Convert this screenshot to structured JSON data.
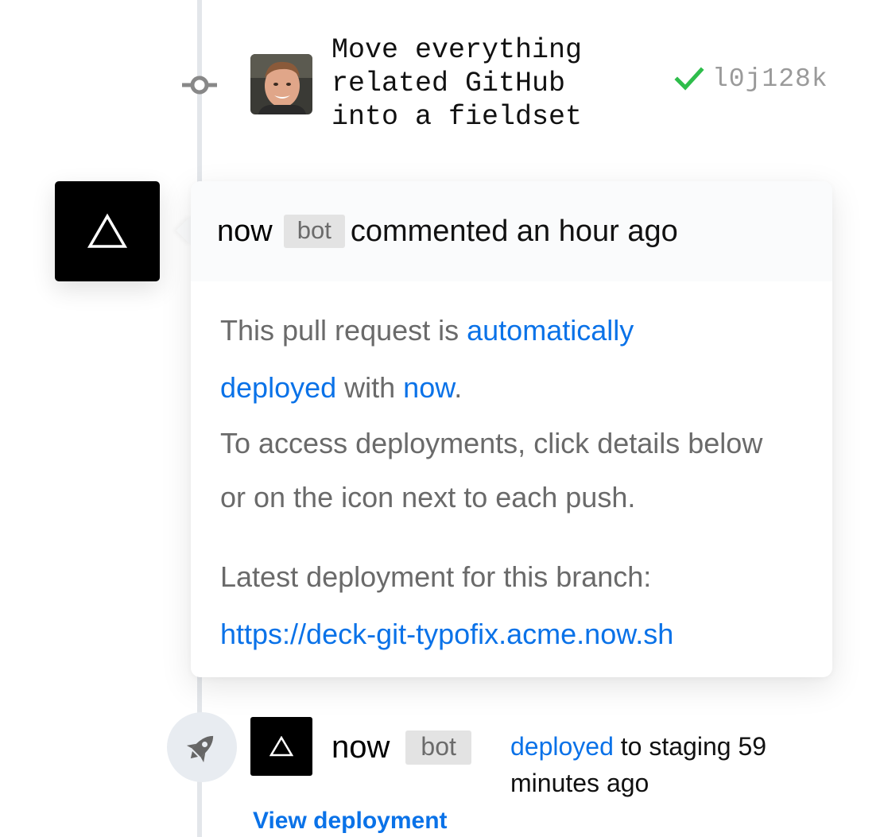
{
  "commit": {
    "message": "Move everything\nrelated GitHub\ninto a fieldset",
    "sha": "l0j128k",
    "status_icon": "check-icon",
    "status_color": "#2ebd4b"
  },
  "comment": {
    "author": "now",
    "badge": "bot",
    "meta": "commented an hour ago",
    "body": {
      "p1_text1": "This pull request is ",
      "p1_link1": "automatically deployed",
      "p1_text2": " with ",
      "p1_link2": "now",
      "p1_text3": ".",
      "p2": "To access deployments, click details below or on the icon next to each push.",
      "p3_label": "Latest deployment for this branch:",
      "p3_link": "https://deck-git-typofix.acme.now.sh"
    }
  },
  "deploy": {
    "icon": "rocket-icon",
    "author": "now",
    "badge": "bot",
    "link": "deployed",
    "text": " to staging 59 minutes ago",
    "view_label": "View deployment"
  },
  "colors": {
    "link": "#0a72e8",
    "timeline": "#e3e6ea"
  }
}
